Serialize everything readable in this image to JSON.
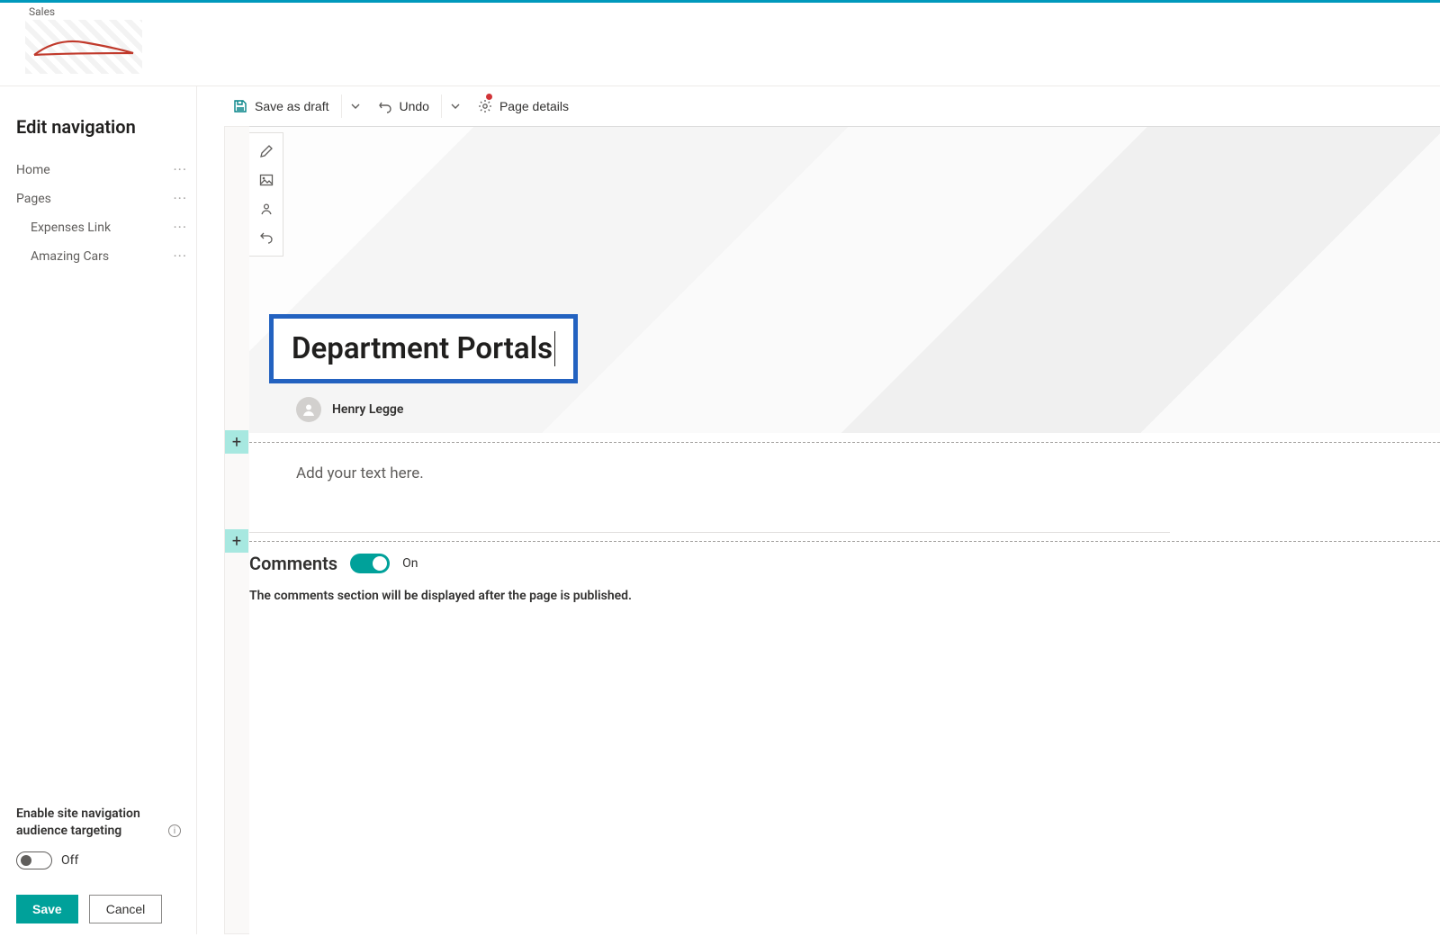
{
  "site": {
    "name": "Sales"
  },
  "leftpanel": {
    "heading": "Edit navigation",
    "items": [
      {
        "label": "Home",
        "indent": false
      },
      {
        "label": "Pages",
        "indent": false
      },
      {
        "label": "Expenses Link",
        "indent": true
      },
      {
        "label": "Amazing Cars",
        "indent": true
      }
    ],
    "audience_label": "Enable site navigation audience targeting",
    "audience_toggle_state": "Off",
    "save_label": "Save",
    "cancel_label": "Cancel"
  },
  "cmdbar": {
    "save_draft": "Save as draft",
    "undo": "Undo",
    "page_details": "Page details"
  },
  "page": {
    "title": "Department Portals",
    "author": "Henry Legge",
    "body_placeholder": "Add your text here."
  },
  "comments": {
    "heading": "Comments",
    "toggle_state": "On",
    "note": "The comments section will be displayed after the page is published."
  }
}
